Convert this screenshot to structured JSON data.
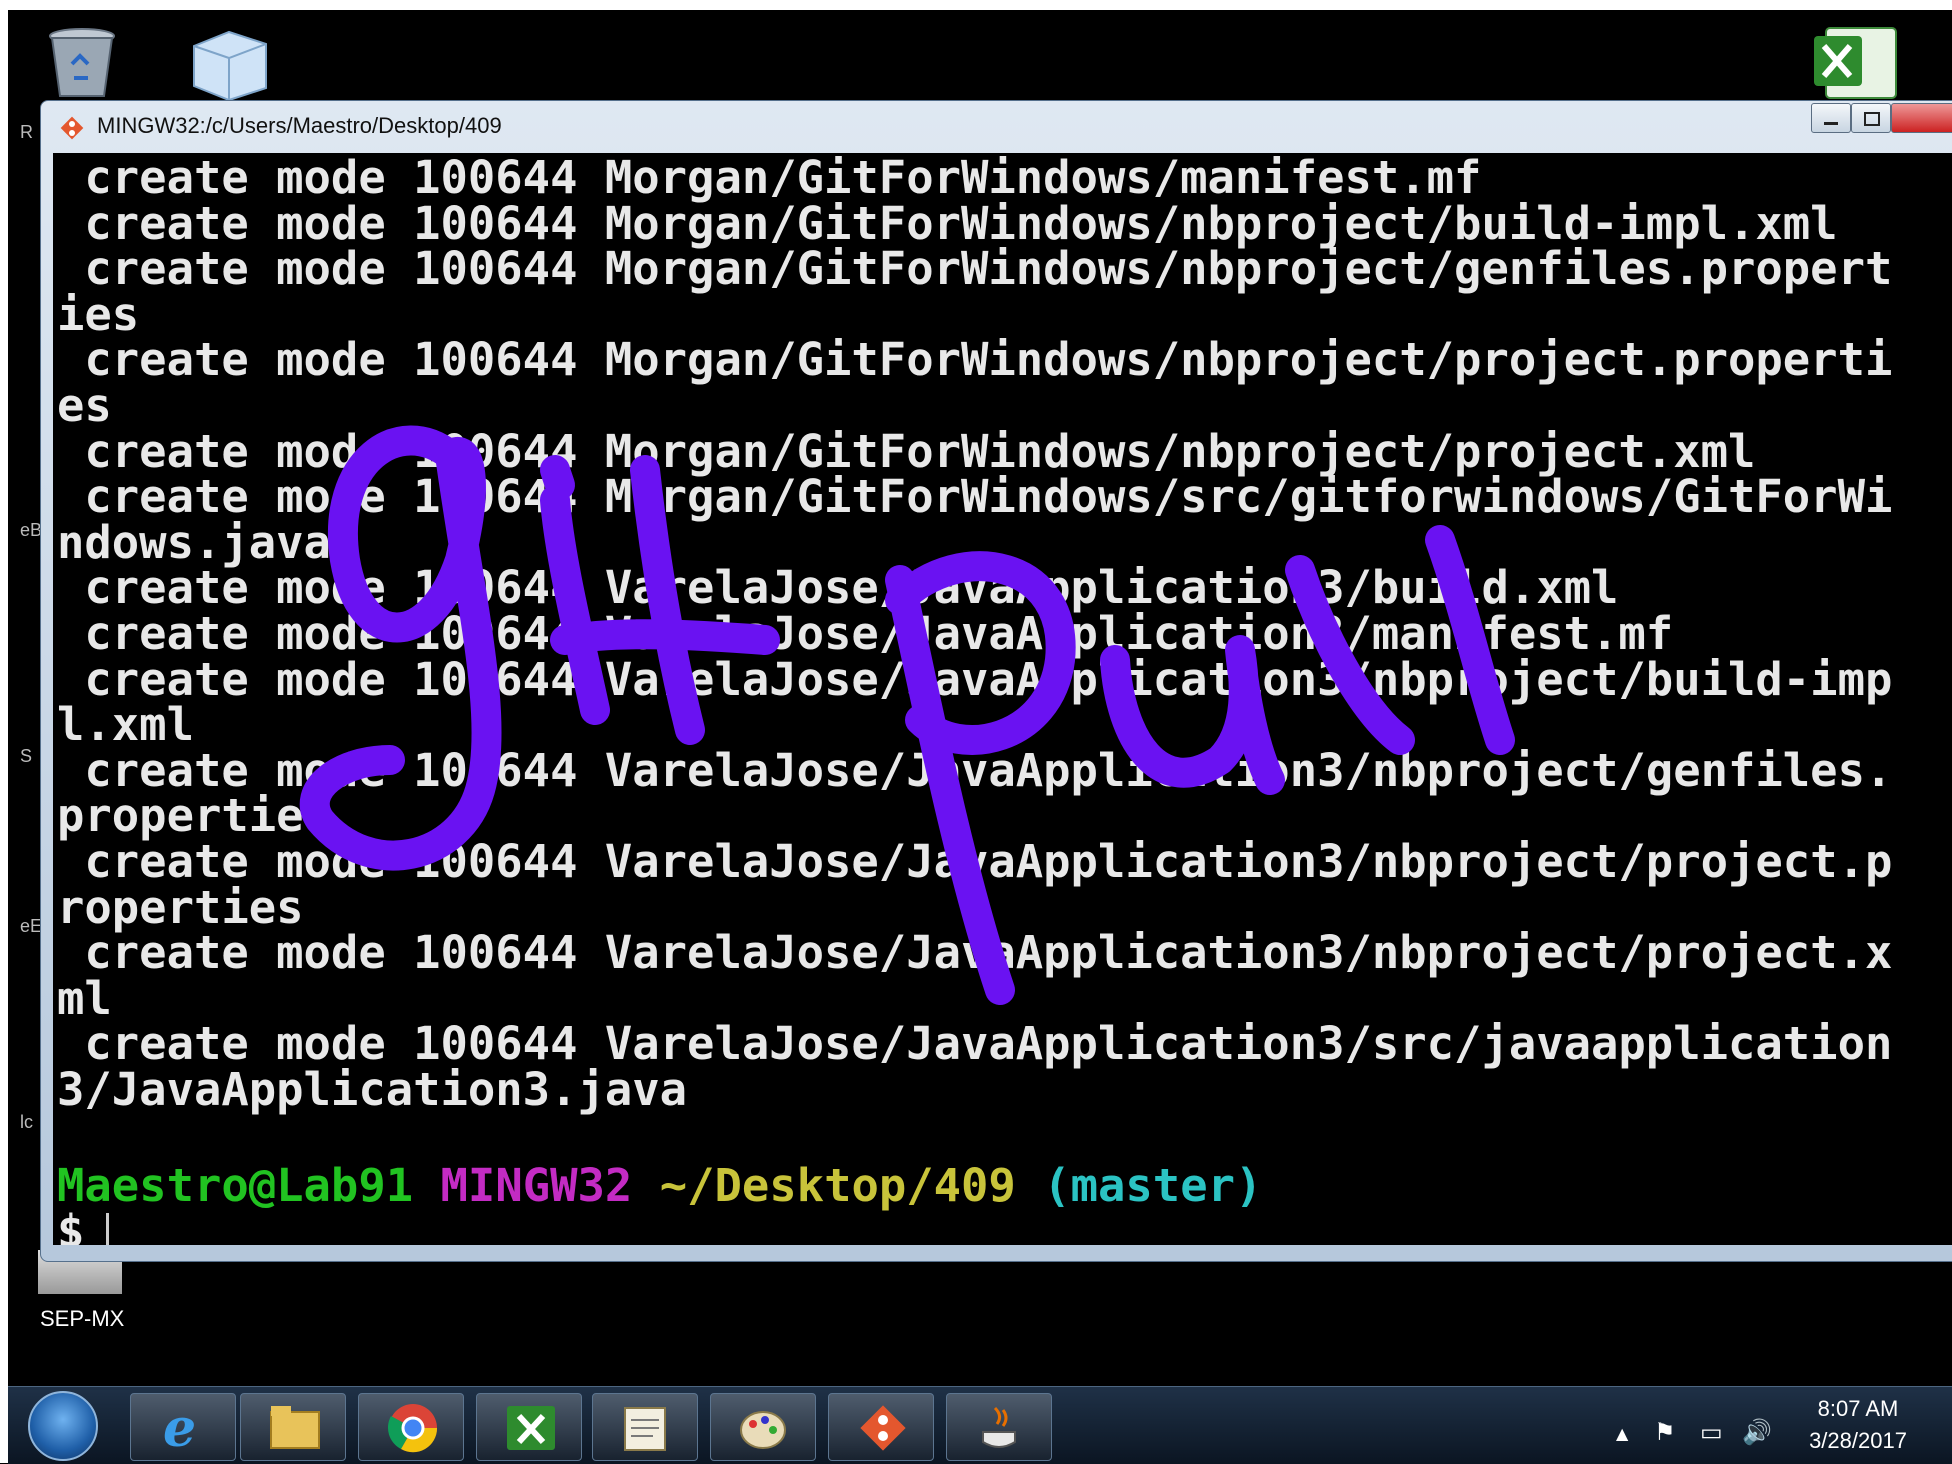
{
  "window": {
    "title": "MINGW32:/c/Users/Maestro/Desktop/409"
  },
  "terminal": {
    "lines": [
      " create mode 100644 Morgan/GitForWindows/manifest.mf",
      " create mode 100644 Morgan/GitForWindows/nbproject/build-impl.xml",
      " create mode 100644 Morgan/GitForWindows/nbproject/genfiles.propert",
      "ies",
      " create mode 100644 Morgan/GitForWindows/nbproject/project.properti",
      "es",
      " create mode 100644 Morgan/GitForWindows/nbproject/project.xml",
      " create mode 100644 Morgan/GitForWindows/src/gitforwindows/GitForWi",
      "ndows.java",
      " create mode 100644 VarelaJose/JavaApplication3/build.xml",
      " create mode 100644 VarelaJose/JavaApplication3/manifest.mf",
      " create mode 100644 VarelaJose/JavaApplication3/nbproject/build-imp",
      "l.xml",
      " create mode 100644 VarelaJose/JavaApplication3/nbproject/genfiles.",
      "propertie",
      " create mode 100644 VarelaJose/JavaApplication3/nbproject/project.p",
      "roperties",
      " create mode 100644 VarelaJose/JavaApplication3/nbproject/project.x",
      "ml",
      " create mode 100644 VarelaJose/JavaApplication3/src/javaapplication",
      "3/JavaApplication3.java"
    ],
    "prompt": {
      "user": "Maestro@Lab91",
      "system": "MINGW32",
      "path": "~/Desktop/409",
      "branch": "(master)",
      "symbol": "$"
    }
  },
  "desktop": {
    "sepmx_label": "SEP-MX",
    "edge_letters": [
      "R",
      "eB",
      "S",
      "eE",
      "lc"
    ]
  },
  "annotation": {
    "handwriting_text": "gitpull",
    "color": "#6a12f2"
  },
  "tray": {
    "time": "8:07 AM",
    "date": "3/28/2017"
  },
  "taskbar": {
    "buttons": [
      "internet-explorer-icon",
      "file-explorer-icon",
      "chrome-icon",
      "excel-icon",
      "notepad-icon",
      "paint-icon",
      "git-bash-icon",
      "java-icon"
    ]
  },
  "colors": {
    "prompt_user": "#21c321",
    "prompt_system": "#c32bc3",
    "prompt_path": "#c8c33a",
    "prompt_branch": "#2bc3c3"
  }
}
